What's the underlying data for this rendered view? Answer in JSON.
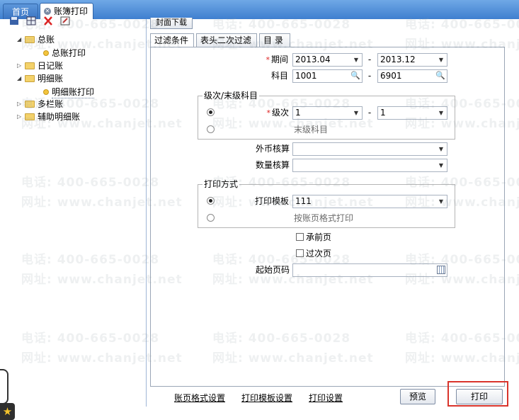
{
  "tabs": {
    "home": "首页",
    "active": "账簿打印"
  },
  "tree": {
    "items": [
      {
        "label": "总账",
        "level": 0,
        "type": "folder",
        "expanded": true
      },
      {
        "label": "总账打印",
        "level": 1,
        "type": "leaf"
      },
      {
        "label": "日记账",
        "level": 0,
        "type": "folder",
        "expanded": false
      },
      {
        "label": "明细账",
        "level": 0,
        "type": "folder",
        "expanded": true
      },
      {
        "label": "明细账打印",
        "level": 1,
        "type": "leaf",
        "selected": true
      },
      {
        "label": "多栏账",
        "level": 0,
        "type": "folder",
        "expanded": false
      },
      {
        "label": "辅助明细账",
        "level": 0,
        "type": "folder",
        "expanded": false
      }
    ]
  },
  "top_button": "封面下载",
  "inner_tabs": [
    "过滤条件",
    "表头二次过滤",
    "目 录"
  ],
  "form": {
    "period_label": "期间",
    "period_from": "2013.04",
    "period_to": "2013.12",
    "subject_label": "科目",
    "subject_from": "1001",
    "subject_to": "6901",
    "level_group_title": "级次/末级科目",
    "level_label": "级次",
    "level_from": "1",
    "level_to": "1",
    "last_level_hint": "末级科目",
    "foreign_label": "外币核算",
    "foreign_value": "",
    "quantity_label": "数量核算",
    "quantity_value": "",
    "print_group_title": "打印方式",
    "template_label": "打印模板",
    "template_value": "111",
    "format_hint": "按账页格式打印",
    "carry_forward_label": "承前页",
    "carry_over_label": "过次页",
    "start_page_label": "起始页码",
    "start_page_value": "",
    "dash": "-"
  },
  "footer": {
    "link_page_format": "账页格式设置",
    "link_template": "打印模板设置",
    "link_print_settings": "打印设置",
    "preview": "预览",
    "print": "打印"
  },
  "watermark": {
    "phone": "电话: 400-665-0028",
    "site": "网址: www.chanjet.net"
  },
  "colors": {
    "tabbar": "#3f7fcf",
    "required": "#d22222",
    "highlight": "#d9342b"
  }
}
